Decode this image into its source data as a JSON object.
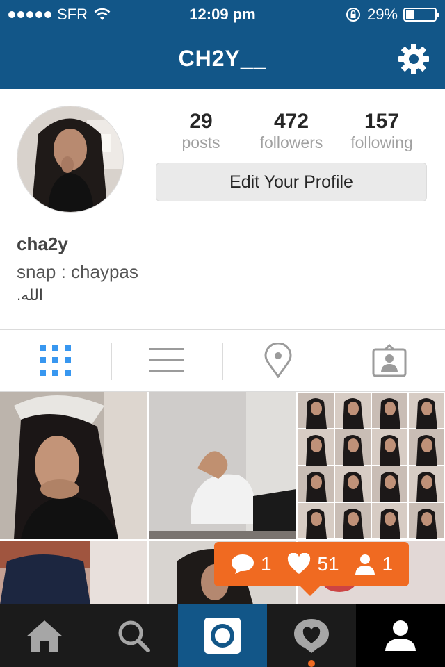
{
  "status_bar": {
    "carrier": "SFR",
    "time": "12:09 pm",
    "battery": "29%",
    "battery_level": 0.29,
    "icons": [
      "signal-dots-icon",
      "wifi-icon",
      "rotation-lock-icon",
      "battery-icon"
    ]
  },
  "header": {
    "title": "CH2Y__",
    "settings_icon": "gear-icon"
  },
  "profile": {
    "stats": [
      {
        "value": "29",
        "label": "posts"
      },
      {
        "value": "472",
        "label": "followers"
      },
      {
        "value": "157",
        "label": "following"
      }
    ],
    "edit_button": "Edit Your Profile",
    "name": "cha2y",
    "bio_line1": "snap : chaypas",
    "bio_line2": ".الله"
  },
  "view_tabs": [
    {
      "name": "grid-view",
      "icon": "grid-icon",
      "active": true
    },
    {
      "name": "list-view",
      "icon": "list-icon",
      "active": false
    },
    {
      "name": "map-view",
      "icon": "location-pin-icon",
      "active": false
    },
    {
      "name": "tagged-view",
      "icon": "tagged-person-icon",
      "active": false
    }
  ],
  "notification": {
    "comments": "1",
    "likes": "51",
    "follows": "1"
  },
  "tab_bar": [
    {
      "name": "home",
      "icon": "home-icon"
    },
    {
      "name": "explore",
      "icon": "search-icon"
    },
    {
      "name": "camera",
      "icon": "camera-icon"
    },
    {
      "name": "activity",
      "icon": "activity-heart-icon"
    },
    {
      "name": "profile",
      "icon": "person-icon"
    }
  ],
  "colors": {
    "header_blue": "#125688",
    "accent_orange": "#f06a21",
    "active_tab_blue": "#3897f0"
  }
}
